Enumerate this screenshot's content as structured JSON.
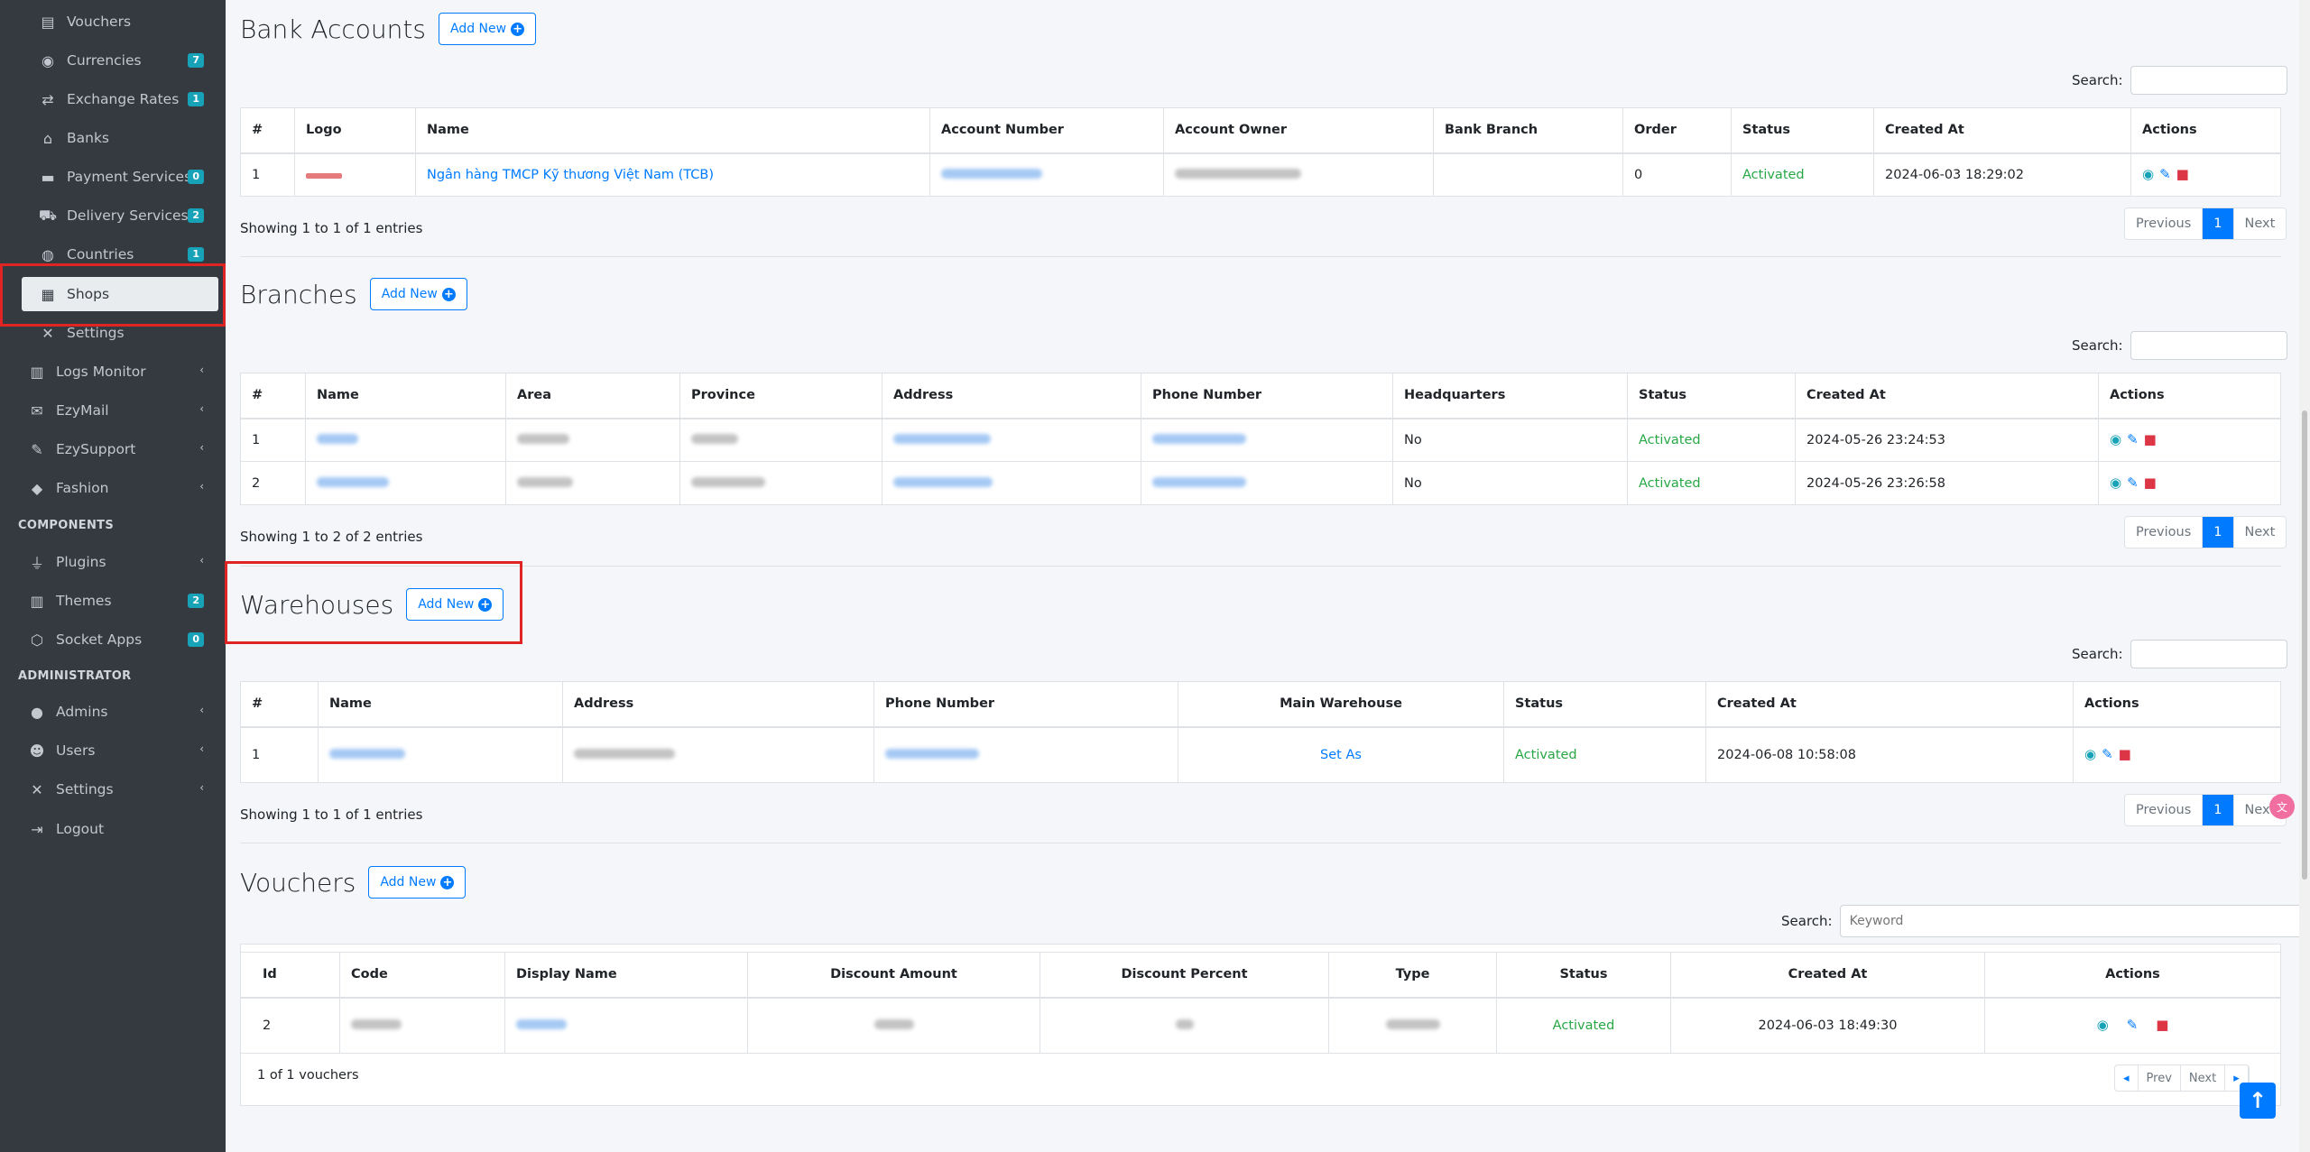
{
  "sidebar": {
    "items": [
      {
        "label": "Vouchers",
        "icon": "ticket-icon",
        "glyph": "▤",
        "badge": ""
      },
      {
        "label": "Currencies",
        "icon": "coins-icon",
        "glyph": "◉",
        "badge": "7"
      },
      {
        "label": "Exchange Rates",
        "icon": "exchange-icon",
        "glyph": "⇄",
        "badge": "1"
      },
      {
        "label": "Banks",
        "icon": "bank-icon",
        "glyph": "⌂",
        "badge": ""
      },
      {
        "label": "Payment Services",
        "icon": "credit-card-icon",
        "glyph": "▬",
        "badge": "0"
      },
      {
        "label": "Delivery Services",
        "icon": "truck-icon",
        "glyph": "⛟",
        "badge": "2"
      },
      {
        "label": "Countries",
        "icon": "globe-icon",
        "glyph": "◍",
        "badge": "1"
      },
      {
        "label": "Shops",
        "icon": "store-icon",
        "glyph": "▦",
        "badge": ""
      },
      {
        "label": "Settings",
        "icon": "tools-icon",
        "glyph": "✕",
        "badge": ""
      }
    ],
    "top_items": [
      {
        "label": "Logs Monitor",
        "icon": "book-icon",
        "glyph": "▥"
      },
      {
        "label": "EzyMail",
        "icon": "envelope-icon",
        "glyph": "✉"
      },
      {
        "label": "EzySupport",
        "icon": "support-icon",
        "glyph": "✎"
      },
      {
        "label": "Fashion",
        "icon": "shirt-icon",
        "glyph": "◆"
      }
    ],
    "components_header": "COMPONENTS",
    "component_items": [
      {
        "label": "Plugins",
        "icon": "plug-icon",
        "glyph": "⏚",
        "badge": "",
        "chev": "‹"
      },
      {
        "label": "Themes",
        "icon": "book-icon",
        "glyph": "▥",
        "badge": "2",
        "chev": ""
      },
      {
        "label": "Socket Apps",
        "icon": "network-icon",
        "glyph": "⬡",
        "badge": "0",
        "chev": ""
      }
    ],
    "admin_header": "ADMINISTRATOR",
    "admin_items": [
      {
        "label": "Admins",
        "icon": "user-circle-icon",
        "glyph": "●",
        "chev": "‹"
      },
      {
        "label": "Users",
        "icon": "users-icon",
        "glyph": "☻",
        "chev": "‹"
      },
      {
        "label": "Settings",
        "icon": "tools-icon",
        "glyph": "✕",
        "chev": "‹"
      },
      {
        "label": "Logout",
        "icon": "logout-icon",
        "glyph": "⇥",
        "chev": ""
      }
    ],
    "chev": "‹"
  },
  "common": {
    "add_new": "Add New",
    "plus": "+",
    "search_label": "Search:",
    "previous": "Previous",
    "next": "Next",
    "page": "1"
  },
  "bank_accounts": {
    "title": "Bank Accounts",
    "columns": [
      "#",
      "Logo",
      "Name",
      "Account Number",
      "Account Owner",
      "Bank Branch",
      "Order",
      "Status",
      "Created At",
      "Actions"
    ],
    "rows": [
      {
        "num": "1",
        "name": "Ngân hàng TMCP Kỹ thương Việt Nam (TCB)",
        "order": "0",
        "status": "Activated",
        "created_at": "2024-06-03 18:29:02"
      }
    ],
    "entries": "Showing 1 to 1 of 1 entries"
  },
  "branches": {
    "title": "Branches",
    "columns": [
      "#",
      "Name",
      "Area",
      "Province",
      "Address",
      "Phone Number",
      "Headquarters",
      "Status",
      "Created At",
      "Actions"
    ],
    "rows": [
      {
        "num": "1",
        "headquarters": "No",
        "status": "Activated",
        "created_at": "2024-05-26 23:24:53"
      },
      {
        "num": "2",
        "headquarters": "No",
        "status": "Activated",
        "created_at": "2024-05-26 23:26:58"
      }
    ],
    "entries": "Showing 1 to 2 of 2 entries"
  },
  "warehouses": {
    "title": "Warehouses",
    "columns": [
      "#",
      "Name",
      "Address",
      "Phone Number",
      "Main Warehouse",
      "Status",
      "Created At",
      "Actions"
    ],
    "rows": [
      {
        "num": "1",
        "main": "Set As",
        "status": "Activated",
        "created_at": "2024-06-08 10:58:08"
      }
    ],
    "entries": "Showing 1 to 1 of 1 entries"
  },
  "vouchers": {
    "title": "Vouchers",
    "search_placeholder": "Keyword",
    "columns": [
      "Id",
      "Code",
      "Display Name",
      "Discount Amount",
      "Discount Percent",
      "Type",
      "Status",
      "Created At",
      "Actions"
    ],
    "rows": [
      {
        "id": "2",
        "status": "Activated",
        "created_at": "2024-06-03 18:49:30"
      }
    ],
    "count": "1 of 1 vouchers",
    "prev": "Prev",
    "next": "Next"
  },
  "colors": {
    "primary": "#007bff",
    "success": "#28a745",
    "danger": "#dc3545",
    "info": "#17a2b8",
    "sidebar": "#343a40",
    "highlight": "#e02424"
  }
}
